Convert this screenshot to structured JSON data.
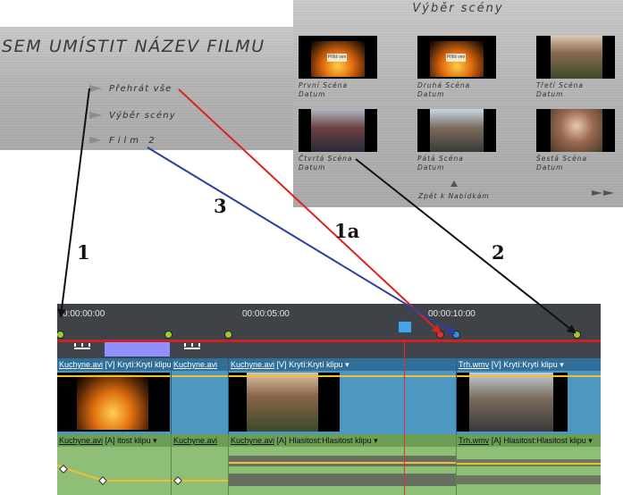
{
  "main_menu": {
    "title": "SEM UMÍSTIT NÁZEV FILMU",
    "items": [
      {
        "label": "Přehrát vše"
      },
      {
        "label": "Výběr scény"
      },
      {
        "label": "Film 2"
      }
    ]
  },
  "scene_menu": {
    "title": "Výběr scény",
    "scenes": [
      {
        "name": "První Scéna",
        "date": "Datum",
        "badge": "Příliš ven"
      },
      {
        "name": "Druhá Scéna",
        "date": "Datum",
        "badge": "Příliš ven"
      },
      {
        "name": "Třetí Scéna",
        "date": "Datum"
      },
      {
        "name": "Čtvrtá Scéna",
        "date": "Datum"
      },
      {
        "name": "Pátá Scéna",
        "date": "Datum"
      },
      {
        "name": "Šestá Scéna",
        "date": "Datum"
      }
    ],
    "back_label": "Zpět k Nabídkám"
  },
  "connectors": {
    "c1": {
      "label": "1",
      "color": "#111111"
    },
    "c1a": {
      "label": "1a",
      "color": "#dd2222"
    },
    "c2": {
      "label": "2",
      "color": "#111111"
    },
    "c3": {
      "label": "3",
      "color": "#2b3fa0"
    }
  },
  "timeline": {
    "timecodes": [
      "0:00:00:00",
      "00:00:05:00",
      "00:00:10:00"
    ],
    "video_clips": [
      {
        "name": "Kuchyne.avi",
        "track": "[V]",
        "effect": "Krytí:Krytí klipu"
      },
      {
        "name": "Kuchyne.avi",
        "track": "",
        "effect": ""
      },
      {
        "name": "Kuchyne.avi",
        "track": "[V]",
        "effect": "Krytí:Krytí klipu"
      },
      {
        "name": "Trh.wmv",
        "track": "[V]",
        "effect": "Krytí:Krytí klipu"
      }
    ],
    "audio_clips": [
      {
        "name": "Kuchyne.avi",
        "track": "[A]",
        "effect": "itost klipu"
      },
      {
        "name": "Kuchyne.avi",
        "track": "",
        "effect": ""
      },
      {
        "name": "Kuchyne.avi",
        "track": "[A]",
        "effect": "Hlasitost:Hlasitost klipu"
      },
      {
        "name": "Trh.wmv",
        "track": "[A]",
        "effect": "Hlasitost:Hlasitost klipu"
      }
    ]
  }
}
